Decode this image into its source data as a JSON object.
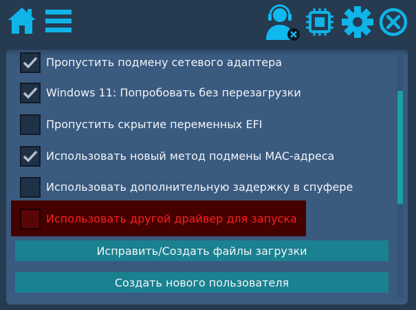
{
  "toolbar": {
    "home_icon": "home-icon",
    "menu_icon": "hamburger-menu-icon",
    "support_icon": "support-agent-icon",
    "chip_icon": "cpu-chip-icon",
    "settings_icon": "gear-icon",
    "close_icon": "close-circle-icon",
    "accent_color": "#0fb4e8",
    "support_color": "#10b8f0"
  },
  "options": [
    {
      "label": "Пропустить подмену сетевого адаптера",
      "checked": true,
      "danger": false
    },
    {
      "label": "Windows 11: Попробовать без перезагрузки",
      "checked": true,
      "danger": false
    },
    {
      "label": "Пропустить скрытие переменных EFI",
      "checked": false,
      "danger": false
    },
    {
      "label": "Использовать новый метод подмены MAC-адреса",
      "checked": true,
      "danger": false
    },
    {
      "label": "Использовать дополнительную задержку в спуфере",
      "checked": false,
      "danger": false
    },
    {
      "label": "Использовать другой драйвер для запуска",
      "checked": false,
      "danger": true
    }
  ],
  "buttons": {
    "fix_boot": "Исправить/Создать файлы загрузки",
    "new_user": "Создать нового пользователя"
  },
  "colors": {
    "background": "#263a50",
    "panel": "#3a5a80",
    "button": "#1a8190",
    "danger_text": "#ff1f1f",
    "danger_bg": "#450000",
    "scroll_thumb": "#1c9fa8"
  }
}
